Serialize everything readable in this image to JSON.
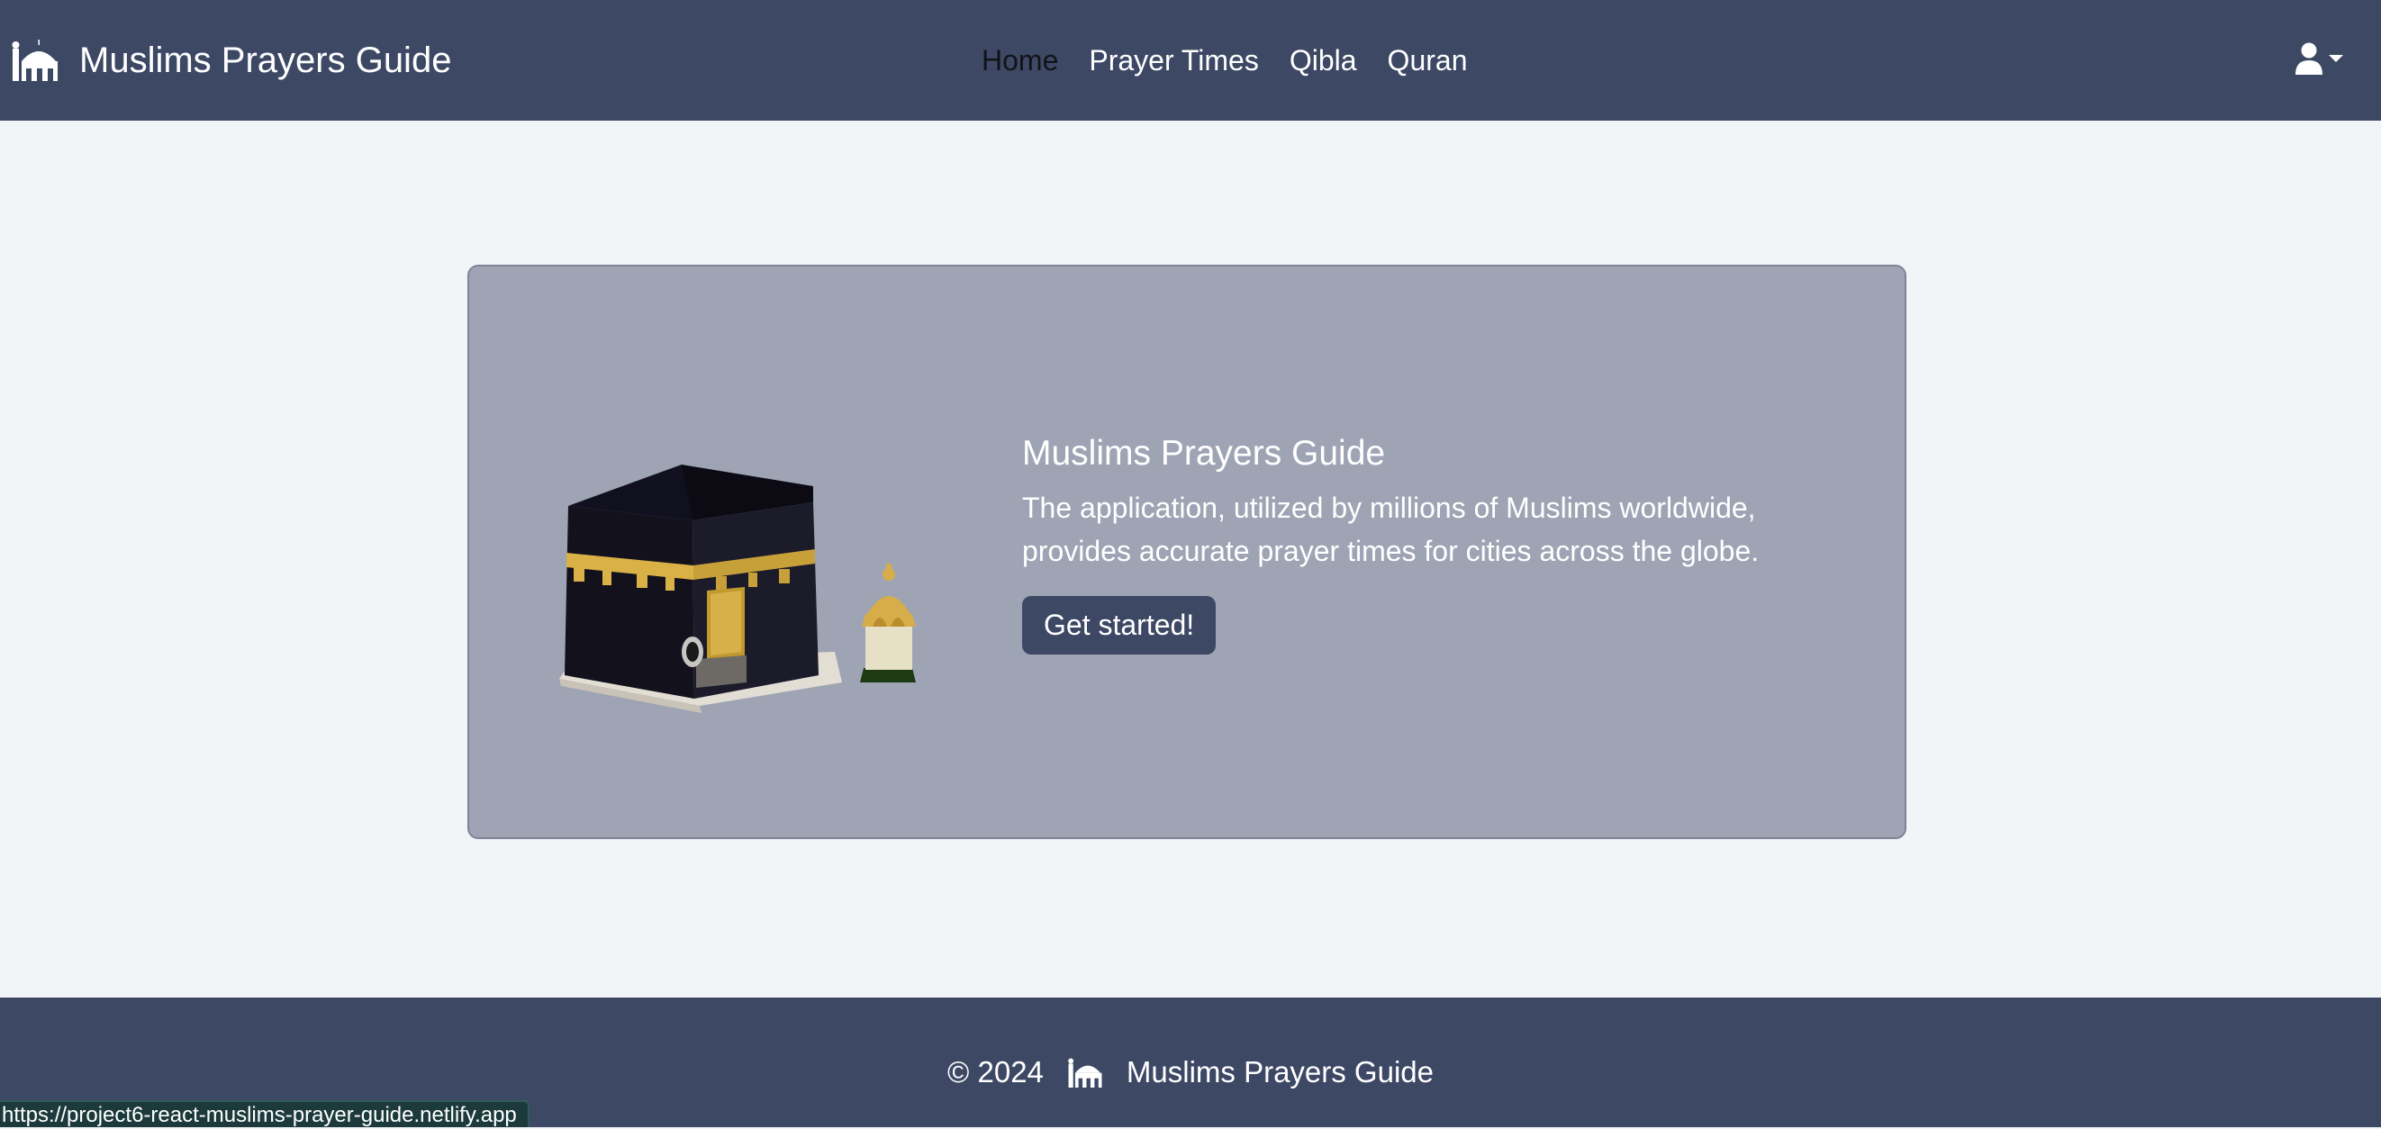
{
  "navbar": {
    "brand": {
      "icon": "mosque-icon",
      "title": "Muslims Prayers Guide"
    },
    "links": [
      {
        "label": "Home",
        "active": true
      },
      {
        "label": "Prayer Times",
        "active": false
      },
      {
        "label": "Qibla",
        "active": false
      },
      {
        "label": "Quran",
        "active": false
      }
    ],
    "user_menu": {
      "icon": "user-icon"
    }
  },
  "hero": {
    "illustration": "kaaba-illustration",
    "title": "Muslims Prayers Guide",
    "description": "The application, utilized by millions of Muslims worldwide, provides accurate prayer times for cities across the globe.",
    "cta_label": "Get started!"
  },
  "footer": {
    "copyright": "© 2024",
    "icon": "mosque-icon",
    "title": "Muslims Prayers Guide"
  },
  "status_bar": {
    "url": "https://project6-react-muslims-prayer-guide.netlify.app"
  },
  "colors": {
    "navbar_bg": "#3d4865",
    "page_bg": "#f2f5f8",
    "hero_bg": "#9ea4b4",
    "button_bg": "#3d4865",
    "active_link": "#111318"
  }
}
